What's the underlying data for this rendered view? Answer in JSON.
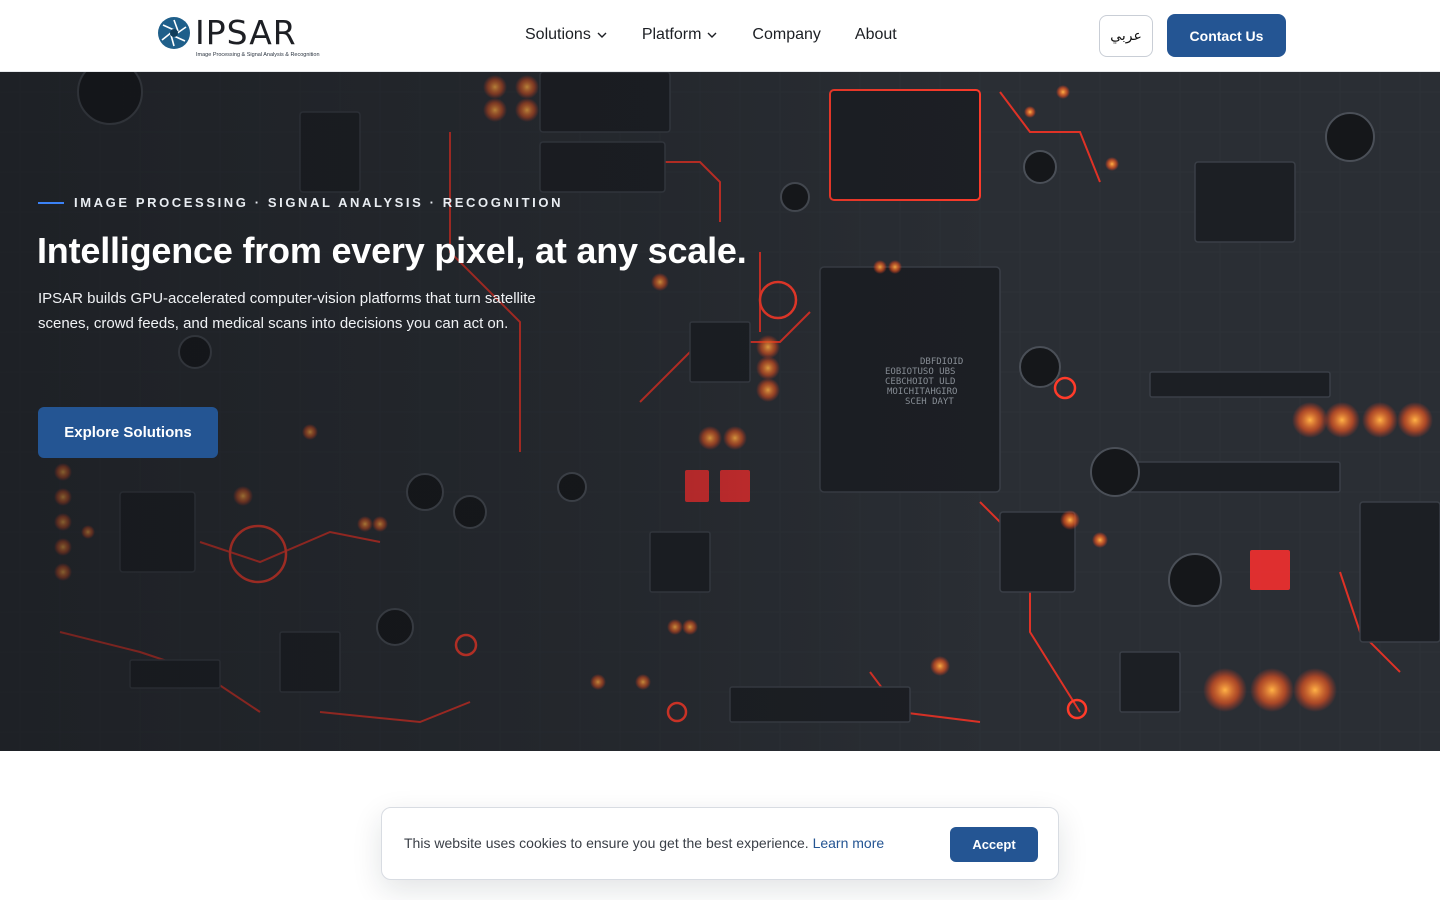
{
  "brand": {
    "name": "IPSAR",
    "tagline": "Image Processing & Signal Analysis & Recognition",
    "accent": "#245593"
  },
  "nav": {
    "items": [
      {
        "label": "Solutions",
        "has_dropdown": true
      },
      {
        "label": "Platform",
        "has_dropdown": true
      },
      {
        "label": "Company",
        "has_dropdown": false
      },
      {
        "label": "About",
        "has_dropdown": false
      }
    ],
    "language_label": "عربي",
    "contact_label": "Contact Us"
  },
  "hero": {
    "eyebrow": "IMAGE PROCESSING · SIGNAL ANALYSIS · RECOGNITION",
    "title": "Intelligence from every pixel, at any scale.",
    "subtitle": "IPSAR builds GPU-accelerated computer-vision platforms that turn satellite scenes, crowd feeds, and medical scans into decisions you can act on.",
    "cta_label": "Explore Solutions",
    "background": "circuit-board-image"
  },
  "cookie_banner": {
    "message": "This website uses cookies to ensure you get the best experience.",
    "link_label": "Learn more",
    "accept_label": "Accept"
  }
}
